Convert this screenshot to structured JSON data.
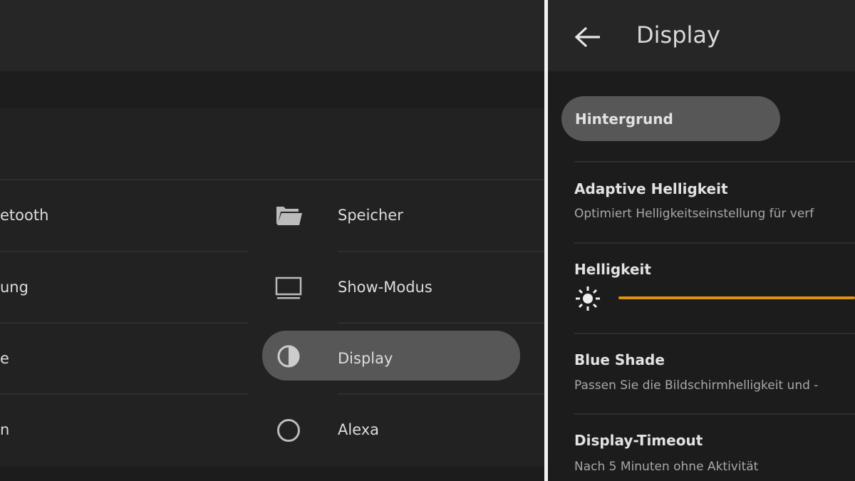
{
  "settings_list": {
    "left_column": [
      {
        "label": "etooth"
      },
      {
        "label": "ung"
      },
      {
        "label": "e"
      },
      {
        "label": "n"
      }
    ],
    "right_column": [
      {
        "label": "Speicher",
        "icon": "folder-icon"
      },
      {
        "label": "Show-Modus",
        "icon": "monitor-icon"
      },
      {
        "label": "Display",
        "icon": "contrast-icon",
        "selected": true
      },
      {
        "label": "Alexa",
        "icon": "alexa-ring-icon"
      }
    ]
  },
  "display_panel": {
    "title": "Display",
    "back_icon": "arrow-left-icon",
    "hintergrund_label": "Hintergrund",
    "items": [
      {
        "title": "Adaptive Helligkeit",
        "subtitle": "Optimiert Helligkeitseinstellung für verf"
      },
      {
        "title": "Helligkeit",
        "slider_icon": "sun-icon"
      },
      {
        "title": "Blue Shade",
        "subtitle": "Passen Sie die Bildschirmhelligkeit und -"
      },
      {
        "title": "Display-Timeout",
        "subtitle": "Nach 5 Minuten ohne Aktivität"
      }
    ]
  },
  "colors": {
    "accent": "#e0940e",
    "selected_bg": "#575757"
  }
}
